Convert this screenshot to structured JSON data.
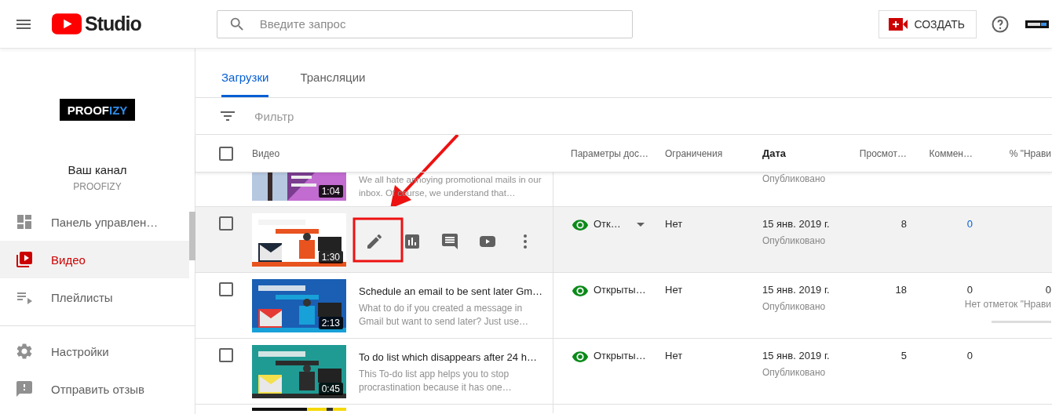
{
  "header": {
    "logo_text": "Studio",
    "search": {
      "placeholder": "Введите запрос"
    },
    "create_button": "СОЗДАТЬ"
  },
  "sidebar": {
    "channel_logo": {
      "text": "PROOF",
      "accent": "IZY"
    },
    "channel_title": "Ваш канал",
    "channel_name": "PROOFIZY",
    "items": [
      {
        "label": "Панель управлен…",
        "selected": false
      },
      {
        "label": "Видео",
        "selected": true
      },
      {
        "label": "Плейлисты",
        "selected": false
      }
    ],
    "secondary_items": [
      {
        "label": "Настройки",
        "selected": false
      },
      {
        "label": "Отправить отзыв",
        "selected": false
      }
    ]
  },
  "tabs": [
    {
      "label": "Загрузки",
      "selected": true
    },
    {
      "label": "Трансляции",
      "selected": false
    }
  ],
  "filter": {
    "placeholder": "Фильтр"
  },
  "table": {
    "select_all_checked": false,
    "columns": [
      {
        "label": "Видео",
        "bold": false
      },
      {
        "label": "Параметры дос…",
        "bold": false
      },
      {
        "label": "Ограничения",
        "bold": false
      },
      {
        "label": "Дата",
        "bold": true
      },
      {
        "label": "Просмот…",
        "bold": false
      },
      {
        "label": "Коммен…",
        "bold": false
      },
      {
        "label": "% \"Нрави",
        "bold": false
      }
    ],
    "rows": [
      {
        "kind": "partial_top",
        "duration": "1:04",
        "description": "We all hate annoying promotional mails in our inbox. Of course, we understand that…",
        "status": "Опубликовано"
      },
      {
        "kind": "full",
        "highlighted": true,
        "checked": false,
        "duration": "1:30",
        "show_actions": true,
        "access": "Отк…",
        "access_menu": true,
        "restrictions": "Нет",
        "date": "15 янв. 2019 г.",
        "status": "Опубликовано",
        "views": "8",
        "comments": "0",
        "comments_link": true
      },
      {
        "kind": "full",
        "highlighted": false,
        "checked": false,
        "duration": "2:13",
        "show_actions": false,
        "title": "Schedule an email to be sent later Gm…",
        "description": "What to do if you created a message in Gmail but want to send later? Just use…",
        "access": "Открыты…",
        "access_menu": false,
        "restrictions": "Нет",
        "date": "15 янв. 2019 г.",
        "status": "Опубликовано",
        "views": "18",
        "comments": "0",
        "comments_link": false,
        "likes": "0",
        "likes_note": "Нет отметок \"Нрави",
        "likes_bar": true
      },
      {
        "kind": "full",
        "highlighted": false,
        "checked": false,
        "duration": "0:45",
        "show_actions": false,
        "title": "To do list which disappears after 24 h…",
        "description": "This To-do list app helps you to stop procrastination because it has one…",
        "access": "Открыты…",
        "access_menu": false,
        "restrictions": "Нет",
        "date": "15 янв. 2019 г.",
        "status": "Опубликовано",
        "views": "5",
        "comments": "0",
        "comments_link": false
      },
      {
        "kind": "partial_bottom"
      }
    ]
  },
  "annotations": {
    "arrow": true,
    "frame": true
  }
}
